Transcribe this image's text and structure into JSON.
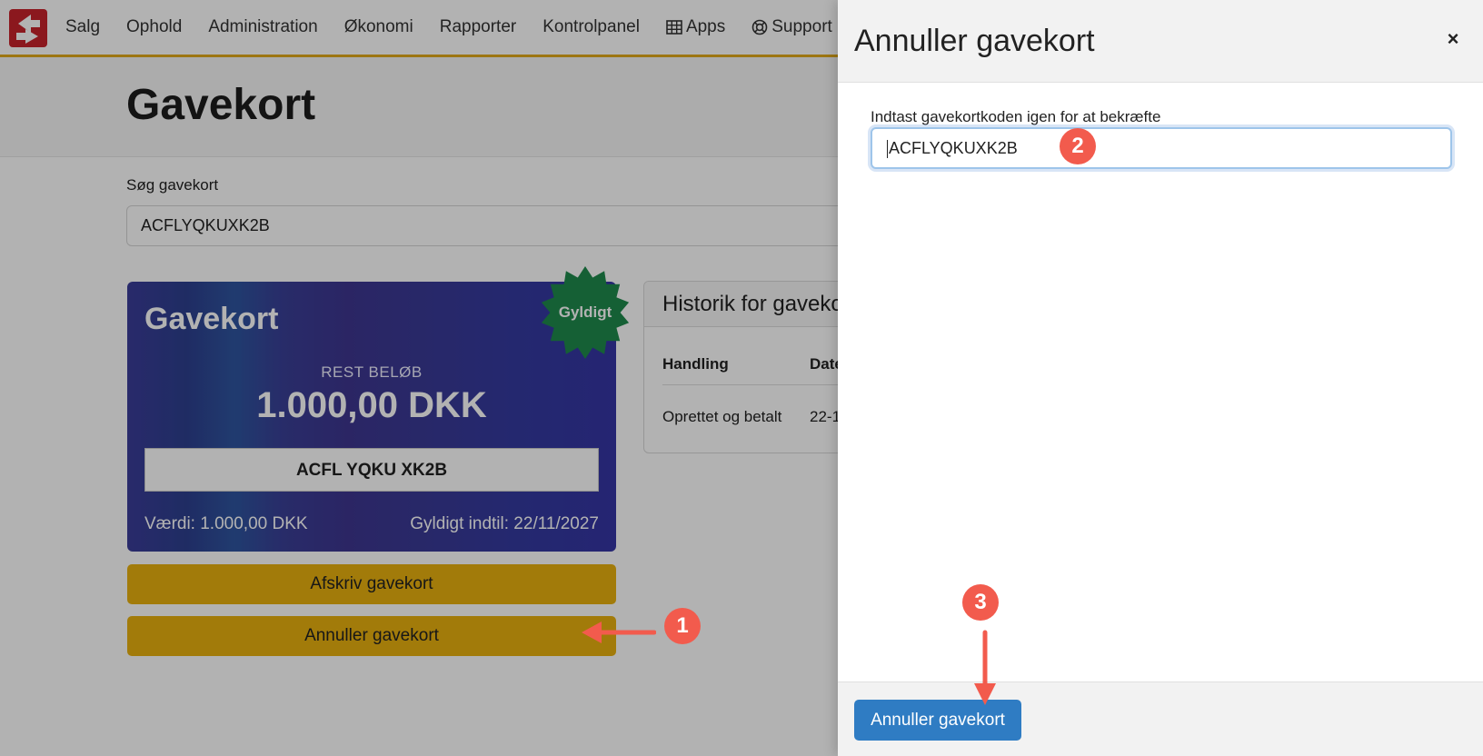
{
  "navbar": {
    "items": [
      {
        "label": "Salg"
      },
      {
        "label": "Ophold"
      },
      {
        "label": "Administration"
      },
      {
        "label": "Økonomi"
      },
      {
        "label": "Rapporter"
      },
      {
        "label": "Kontrolpanel"
      },
      {
        "label": "Apps",
        "icon": "grid-icon"
      },
      {
        "label": "Support",
        "icon": "lifebuoy-icon"
      }
    ],
    "accent_color": "#e1a91a",
    "logo_color": "#c8232c"
  },
  "page": {
    "title": "Gavekort",
    "search_label": "Søg gavekort",
    "search_value": "ACFLYQKUXK2B"
  },
  "gift_card": {
    "title": "Gavekort",
    "rest_label": "REST BELØB",
    "amount": "1.000,00 DKK",
    "code": "ACFL YQKU XK2B",
    "value_text": "Værdi: 1.000,00 DKK",
    "valid_until_text": "Gyldigt indtil: 22/11/2027",
    "badge": "Gyldigt",
    "badge_color": "#1f8a4c"
  },
  "actions": {
    "writeoff_label": "Afskriv gavekort",
    "cancel_label": "Annuller gavekort",
    "button_color": "#e8b00f"
  },
  "history": {
    "title": "Historik for gaveko",
    "col_action": "Handling",
    "col_date": "Date",
    "rows": [
      {
        "action": "Oprettet og betalt",
        "date": "22-1"
      }
    ]
  },
  "panel": {
    "title": "Annuller gavekort",
    "close_glyph": "×",
    "confirm_label": "Indtast gavekortkoden igen for at bekræfte",
    "confirm_value": "ACFLYQKUXK2B",
    "submit_label": "Annuller gavekort",
    "submit_color": "#2f7cc3"
  },
  "annotations": {
    "step1": "1",
    "step2": "2",
    "step3": "3",
    "color": "#f25b4d"
  }
}
